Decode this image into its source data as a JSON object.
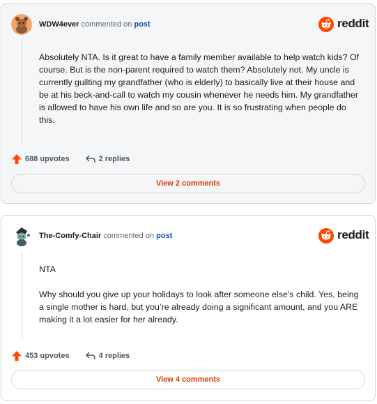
{
  "brand": {
    "name": "reddit",
    "color": "#ff4500"
  },
  "comments": [
    {
      "username": "WDW4ever",
      "action_text": "commented on",
      "target_link": "post",
      "avatar_icon": "snoo-avatar-icon",
      "paragraphs": [
        "Absolutely NTA. Is it great to have a family member available to help watch kids? Of course. But is the non-parent required to watch them? Absolutely not. My uncle is currently guilting my grandfather (who is elderly) to basically live at their house and be at his beck-and-call to watch my cousin whenever he needs him. My grandfather is allowed to have his own life and so are you. It is so frustrating when people do this."
      ],
      "upvotes": "688 upvotes",
      "replies": "2 replies",
      "view_label": "View 2 comments"
    },
    {
      "username": "The-Comfy-Chair",
      "action_text": "commented on",
      "target_link": "post",
      "avatar_icon": "snoo-avatar-icon",
      "paragraphs": [
        "NTA",
        "Why should you give up your holidays to look after someone else’s child. Yes, being a single mother is hard, but you’re already doing a significant amount, and you ARE making it a lot easier for her already."
      ],
      "upvotes": "453 upvotes",
      "replies": "4 replies",
      "view_label": "View 4 comments"
    }
  ]
}
